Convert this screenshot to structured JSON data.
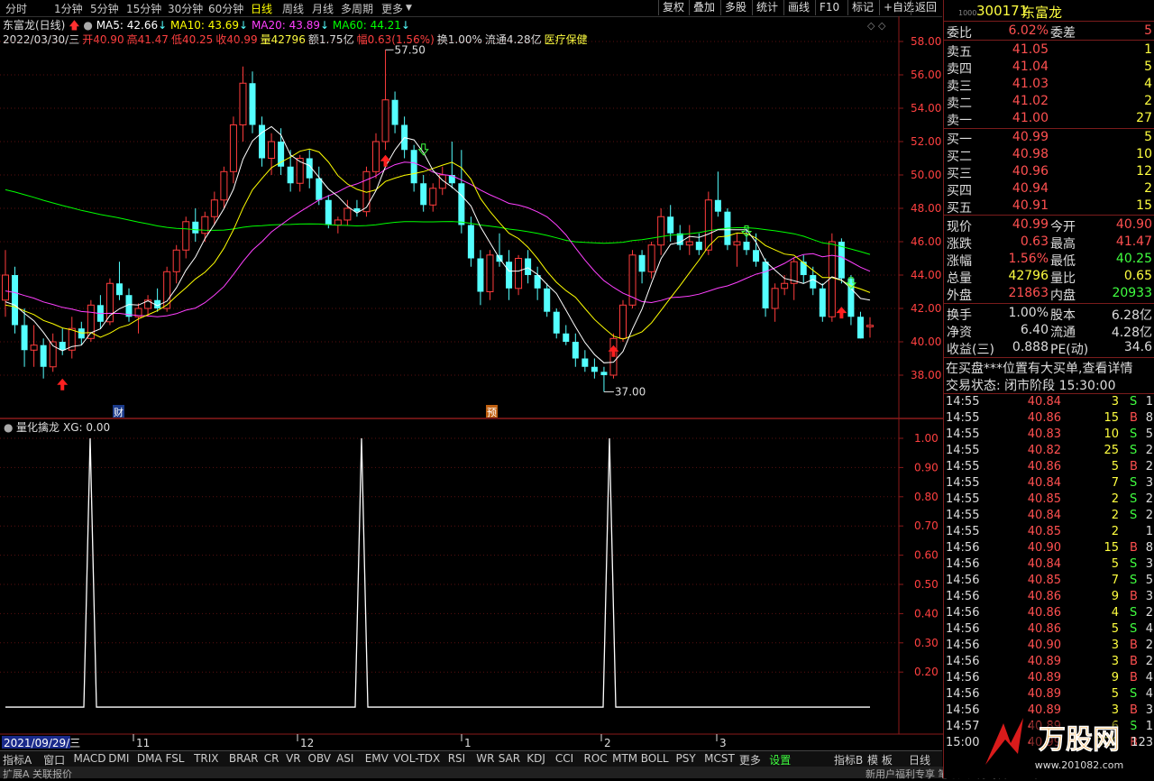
{
  "toolbar": {
    "periods": [
      "分时",
      "1分钟",
      "5分钟",
      "15分钟",
      "30分钟",
      "60分钟",
      "日线",
      "周线",
      "月线",
      "多周期",
      "更多"
    ],
    "active_period": "日线",
    "right_buttons": [
      "复权",
      "叠加",
      "多股",
      "统计",
      "画线",
      "F10",
      "标记",
      "+自选",
      "返回"
    ]
  },
  "stock": {
    "code": "300171",
    "name": "东富龙"
  },
  "main_info": {
    "title": "东富龙(日线)",
    "ma5": "MA5: 42.66",
    "ma10": "MA10: 43.69",
    "ma20": "MA20: 43.89",
    "ma60": "MA60: 44.21",
    "line2": [
      {
        "t": "2022/03/30/三",
        "c": "#dddddd"
      },
      {
        "t": "开40.90",
        "c": "#ff4040"
      },
      {
        "t": "高41.47",
        "c": "#ff4040"
      },
      {
        "t": "低40.25",
        "c": "#ff4040"
      },
      {
        "t": "收40.99",
        "c": "#ff4040"
      },
      {
        "t": "量42796",
        "c": "#ffff40"
      },
      {
        "t": "额1.75亿",
        "c": "#dddddd"
      },
      {
        "t": "幅0.63(1.56%)",
        "c": "#ff4040"
      },
      {
        "t": "换1.00%",
        "c": "#dddddd"
      },
      {
        "t": "流通4.28亿",
        "c": "#dddddd"
      },
      {
        "t": "医疗保健",
        "c": "#ffff40"
      }
    ],
    "high_label": "57.50",
    "low_label": "37.00",
    "marker_cai": "财",
    "marker_yu": "预"
  },
  "sub_info": {
    "title": "量化擒龙",
    "xg": "XG: 0.00"
  },
  "price_axis": [
    "58.00",
    "56.00",
    "54.00",
    "52.00",
    "50.00",
    "48.00",
    "46.00",
    "44.00",
    "42.00",
    "40.00",
    "38.00"
  ],
  "sub_axis": [
    "1.00",
    "0.90",
    "0.80",
    "0.70",
    "0.60",
    "0.50",
    "0.40",
    "0.30",
    "0.20"
  ],
  "date_axis": {
    "start": "2021/09/29/三",
    "months": [
      "11",
      "12",
      "1",
      "2",
      "3"
    ]
  },
  "bottom_tabs": [
    "指标A",
    "窗口",
    "MACD",
    "DMI",
    "DMA",
    "FSL",
    "TRIX",
    "BRAR",
    "CR",
    "VR",
    "OBV",
    "ASI",
    "EMV",
    "VOL-TDX",
    "RSI",
    "WR",
    "SAR",
    "KDJ",
    "CCI",
    "ROC",
    "MTM",
    "BOLL",
    "PSY",
    "MCST",
    "更多",
    "设置"
  ],
  "bottom_right": [
    "指标B",
    "模 板",
    "日线"
  ],
  "order_book": {
    "weibi": {
      "label": "委比",
      "value": "6.02%",
      "label2": "委差",
      "value2": "5"
    },
    "sells": [
      {
        "label": "卖五",
        "price": "41.05",
        "vol": "1"
      },
      {
        "label": "卖四",
        "price": "41.04",
        "vol": "5"
      },
      {
        "label": "卖三",
        "price": "41.03",
        "vol": "4"
      },
      {
        "label": "卖二",
        "price": "41.02",
        "vol": "2"
      },
      {
        "label": "卖一",
        "price": "41.00",
        "vol": "27"
      }
    ],
    "buys": [
      {
        "label": "买一",
        "price": "40.99",
        "vol": "5"
      },
      {
        "label": "买二",
        "price": "40.98",
        "vol": "10"
      },
      {
        "label": "买三",
        "price": "40.96",
        "vol": "12"
      },
      {
        "label": "买四",
        "price": "40.94",
        "vol": "2"
      },
      {
        "label": "买五",
        "price": "40.91",
        "vol": "15"
      }
    ]
  },
  "quote": [
    {
      "l1": "现价",
      "v1": "40.99",
      "c1": "#ff5050",
      "l2": "今开",
      "v2": "40.90",
      "c2": "#ff5050"
    },
    {
      "l1": "涨跌",
      "v1": "0.63",
      "c1": "#ff5050",
      "l2": "最高",
      "v2": "41.47",
      "c2": "#ff5050"
    },
    {
      "l1": "涨幅",
      "v1": "1.56%",
      "c1": "#ff5050",
      "l2": "最低",
      "v2": "40.25",
      "c2": "#40ff40"
    },
    {
      "l1": "总量",
      "v1": "42796",
      "c1": "#ffff40",
      "l2": "量比",
      "v2": "0.65",
      "c2": "#ffff40"
    },
    {
      "l1": "外盘",
      "v1": "21863",
      "c1": "#ff5050",
      "l2": "内盘",
      "v2": "20933",
      "c2": "#40ff40"
    },
    {
      "l1": "换手",
      "v1": "1.00%",
      "c1": "#dddddd",
      "l2": "股本",
      "v2": "6.28亿",
      "c2": "#dddddd"
    },
    {
      "l1": "净资",
      "v1": "6.40",
      "c1": "#dddddd",
      "l2": "流通",
      "v2": "4.28亿",
      "c2": "#dddddd"
    },
    {
      "l1": "收益(三)",
      "v1": "0.888",
      "c1": "#dddddd",
      "l2": "PE(动)",
      "v2": "34.6",
      "c2": "#dddddd"
    }
  ],
  "notice": "在买盘***位置有大买单,查看详情",
  "trade_state": "交易状态: 闭市阶段 15:30:00",
  "ticks": [
    {
      "t": "14:55",
      "p": "40.84",
      "v": "3",
      "d": "S",
      "n": "1"
    },
    {
      "t": "14:55",
      "p": "40.86",
      "v": "15",
      "d": "B",
      "n": "8"
    },
    {
      "t": "14:55",
      "p": "40.83",
      "v": "10",
      "d": "S",
      "n": "5"
    },
    {
      "t": "14:55",
      "p": "40.82",
      "v": "25",
      "d": "S",
      "n": "2"
    },
    {
      "t": "14:55",
      "p": "40.86",
      "v": "5",
      "d": "B",
      "n": "2"
    },
    {
      "t": "14:55",
      "p": "40.84",
      "v": "7",
      "d": "S",
      "n": "3"
    },
    {
      "t": "14:55",
      "p": "40.85",
      "v": "2",
      "d": "S",
      "n": "2"
    },
    {
      "t": "14:55",
      "p": "40.84",
      "v": "2",
      "d": "S",
      "n": "2"
    },
    {
      "t": "14:55",
      "p": "40.85",
      "v": "2",
      "d": "",
      "n": "1"
    },
    {
      "t": "14:56",
      "p": "40.90",
      "v": "15",
      "d": "B",
      "n": "8"
    },
    {
      "t": "14:56",
      "p": "40.84",
      "v": "5",
      "d": "S",
      "n": "3"
    },
    {
      "t": "14:56",
      "p": "40.85",
      "v": "7",
      "d": "S",
      "n": "5"
    },
    {
      "t": "14:56",
      "p": "40.86",
      "v": "9",
      "d": "B",
      "n": "3"
    },
    {
      "t": "14:56",
      "p": "40.86",
      "v": "4",
      "d": "S",
      "n": "2"
    },
    {
      "t": "14:56",
      "p": "40.86",
      "v": "5",
      "d": "S",
      "n": "4"
    },
    {
      "t": "14:56",
      "p": "40.90",
      "v": "3",
      "d": "B",
      "n": "2"
    },
    {
      "t": "14:56",
      "p": "40.89",
      "v": "3",
      "d": "B",
      "n": "2"
    },
    {
      "t": "14:56",
      "p": "40.89",
      "v": "9",
      "d": "B",
      "n": "4"
    },
    {
      "t": "14:56",
      "p": "40.89",
      "v": "5",
      "d": "S",
      "n": "4"
    },
    {
      "t": "14:56",
      "p": "40.89",
      "v": "3",
      "d": "B",
      "n": "3"
    },
    {
      "t": "14:57",
      "p": "40.89",
      "v": "6",
      "d": "S",
      "n": "1"
    },
    {
      "t": "15:00",
      "p": "40.99",
      "v": "320",
      "d": "B",
      "n": "123"
    }
  ],
  "status": {
    "left": "扩展A  关联报价",
    "right": "新用户福利专享 笔 价 细 势 联 值 主 筹"
  },
  "watermark": {
    "text": "万股网",
    "url": "www.201082.com"
  },
  "colors": {
    "up": "#ff3c3c",
    "down": "#54ffff",
    "ma5": "#ffffff",
    "ma10": "#ffff00",
    "ma20": "#ff40ff",
    "ma60": "#00ff00",
    "border": "#8b1a1a"
  },
  "chart_data": {
    "type": "candlestick",
    "title": "东富龙(日线)",
    "ylim": [
      37,
      58
    ],
    "candles": [
      [
        42.5,
        45.5,
        41.5,
        44.0
      ],
      [
        44,
        44.5,
        40.5,
        41.0
      ],
      [
        41,
        42,
        38.5,
        39.5
      ],
      [
        39.5,
        41,
        38.5,
        39.8
      ],
      [
        39.8,
        40.2,
        37.8,
        38.5
      ],
      [
        38.5,
        40.5,
        38.2,
        40.0
      ],
      [
        40,
        40.8,
        39.2,
        39.5
      ],
      [
        39.5,
        41.5,
        39,
        40.8
      ],
      [
        40.8,
        41.2,
        39.8,
        40.2
      ],
      [
        40.2,
        42.5,
        40,
        42.2
      ],
      [
        42.2,
        42.8,
        40.8,
        41.2
      ],
      [
        41.2,
        43.8,
        41,
        43.5
      ],
      [
        43.5,
        44.8,
        42.5,
        42.8
      ],
      [
        42.8,
        43.2,
        41.2,
        41.5
      ],
      [
        41.5,
        42.3,
        40.5,
        42.0
      ],
      [
        42,
        42.8,
        41.5,
        42.5
      ],
      [
        42.5,
        43.2,
        41.8,
        42.0
      ],
      [
        42,
        44.5,
        41.8,
        44.2
      ],
      [
        44.2,
        45.8,
        43.5,
        45.5
      ],
      [
        45.5,
        47.5,
        45,
        47.2
      ],
      [
        47.2,
        48,
        46,
        46.5
      ],
      [
        46.5,
        47.8,
        46,
        47.5
      ],
      [
        47.5,
        49,
        47,
        48.5
      ],
      [
        48.5,
        50.5,
        48,
        50.2
      ],
      [
        50.2,
        53.5,
        49.5,
        53.0
      ],
      [
        53,
        56.5,
        52,
        55.5
      ],
      [
        55.5,
        56.2,
        52.5,
        53.0
      ],
      [
        53,
        53.5,
        50.5,
        51.0
      ],
      [
        51,
        52.5,
        50,
        52.0
      ],
      [
        52,
        52.8,
        50,
        50.5
      ],
      [
        50.5,
        51.5,
        49,
        49.5
      ],
      [
        49.5,
        51.2,
        49,
        51.0
      ],
      [
        51,
        51.5,
        49.2,
        49.8
      ],
      [
        49.8,
        50.5,
        48.2,
        48.5
      ],
      [
        48.5,
        48.8,
        46.8,
        47.0
      ],
      [
        47,
        47.5,
        46.5,
        47.3
      ],
      [
        47.3,
        48.5,
        47,
        48.0
      ],
      [
        48,
        48.5,
        47.5,
        47.8
      ],
      [
        47.8,
        50.5,
        47.5,
        50.2
      ],
      [
        50.2,
        52.5,
        49.8,
        52.0
      ],
      [
        52,
        57.5,
        51.5,
        54.5
      ],
      [
        54.5,
        55,
        52.5,
        53.0
      ],
      [
        53,
        53.5,
        51,
        51.5
      ],
      [
        51.5,
        51.8,
        49,
        49.5
      ],
      [
        49.5,
        50,
        47.8,
        48.2
      ],
      [
        48.2,
        49.5,
        47.8,
        49.2
      ],
      [
        49.2,
        50.5,
        48.8,
        50.0
      ],
      [
        50,
        52,
        49.2,
        49.5
      ],
      [
        49.5,
        51.5,
        46.5,
        47.0
      ],
      [
        47,
        47.5,
        44.5,
        45.0
      ],
      [
        45,
        45.5,
        42.2,
        43.0
      ],
      [
        43,
        45.5,
        42.5,
        45.2
      ],
      [
        45.2,
        46.5,
        44.5,
        44.8
      ],
      [
        44.8,
        45.5,
        42.5,
        43.2
      ],
      [
        43.2,
        45.2,
        42.8,
        45.0
      ],
      [
        45,
        45.5,
        43.5,
        44.0
      ],
      [
        44,
        44.5,
        42.5,
        43.2
      ],
      [
        43.2,
        43.5,
        41.5,
        41.8
      ],
      [
        41.8,
        42,
        40.2,
        40.5
      ],
      [
        40.5,
        41,
        39.8,
        40.0
      ],
      [
        40,
        40.5,
        38.5,
        39.0
      ],
      [
        39,
        39.5,
        38.2,
        38.5
      ],
      [
        38.5,
        39,
        37.8,
        38.2
      ],
      [
        38.2,
        38.5,
        37.0,
        38.0
      ],
      [
        38,
        40.5,
        37.8,
        40.2
      ],
      [
        40.2,
        42.5,
        40,
        42.2
      ],
      [
        42.2,
        45.5,
        42,
        45.2
      ],
      [
        45.2,
        45.5,
        43.5,
        44.2
      ],
      [
        44.2,
        46,
        43.8,
        45.8
      ],
      [
        45.8,
        48,
        45.2,
        47.5
      ],
      [
        47.5,
        48.2,
        46,
        46.5
      ],
      [
        46.5,
        47,
        45.5,
        45.8
      ],
      [
        45.8,
        47,
        45.2,
        46.0
      ],
      [
        46,
        46.5,
        45.2,
        45.5
      ],
      [
        45.5,
        49,
        45.2,
        48.5
      ],
      [
        48.5,
        50.2,
        47.5,
        47.8
      ],
      [
        47.8,
        48,
        45.5,
        45.8
      ],
      [
        45.8,
        46.5,
        44.5,
        46.0
      ],
      [
        46,
        46.8,
        45.2,
        45.5
      ],
      [
        45.5,
        46.5,
        44.5,
        44.8
      ],
      [
        44.8,
        45,
        41.5,
        42.0
      ],
      [
        42,
        43.5,
        41.2,
        43.2
      ],
      [
        43.2,
        44,
        42.8,
        43.5
      ],
      [
        43.5,
        45,
        42.5,
        44.8
      ],
      [
        44.8,
        45.2,
        43.5,
        44.0
      ],
      [
        44,
        44.5,
        42.8,
        43.2
      ],
      [
        43.2,
        43.5,
        41.2,
        41.5
      ],
      [
        41.5,
        46.5,
        41.2,
        46.0
      ],
      [
        46,
        46.2,
        43.5,
        43.8
      ],
      [
        43.8,
        44,
        41,
        41.5
      ],
      [
        41.5,
        41.8,
        40.2,
        40.2
      ],
      [
        40.9,
        41.47,
        40.25,
        40.99
      ]
    ],
    "xg_signal_days": [
      23,
      96,
      165
    ]
  }
}
